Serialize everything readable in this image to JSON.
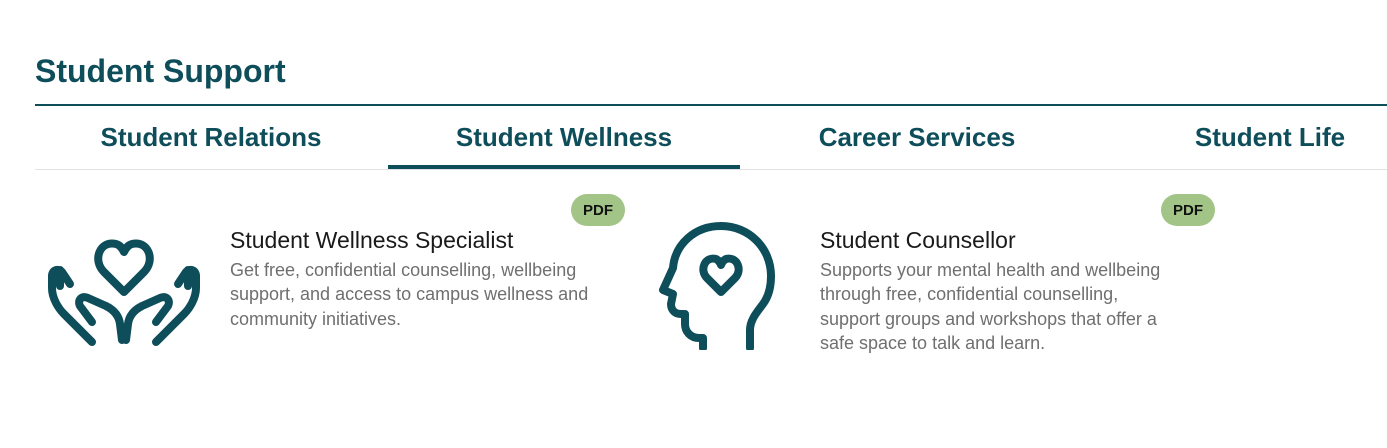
{
  "section": {
    "title": "Student Support"
  },
  "tabs": [
    {
      "label": "Student Relations",
      "active": false
    },
    {
      "label": "Student Wellness",
      "active": true
    },
    {
      "label": "Career Services",
      "active": false
    },
    {
      "label": "Student Life",
      "active": false
    }
  ],
  "cards": [
    {
      "icon": "heart-in-hands-icon",
      "badge": "PDF",
      "title": "Student Wellness Specialist",
      "description": "Get free, confidential counselling, wellbeing support, and access to campus wellness and community initiatives."
    },
    {
      "icon": "head-with-heart-icon",
      "badge": "PDF",
      "title": "Student Counsellor",
      "description": "Supports your mental health and wellbeing through free, confidential counselling, support groups and workshops that offer a safe space to talk and learn."
    }
  ],
  "colors": {
    "brand": "#0e4d5a",
    "badge": "#a2c587",
    "description_text": "#6f6f6f"
  }
}
